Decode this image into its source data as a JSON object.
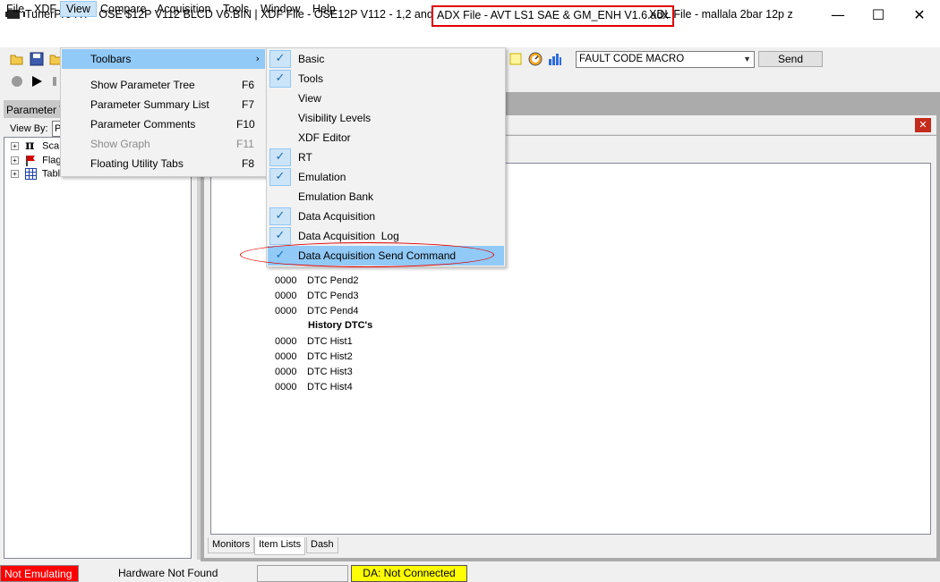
{
  "window": {
    "title_main": "TunerPro RT - OSE $12P V112 BLCD V6.BIN | XDF File - OSE12P V112 - 1,2 and 3 bar.xdf",
    "title_adx": "ADX File - AVT LS1 SAE & GM_ENH V1.6.adx",
    "title_xdl": "XDL File - mallala 2bar 12p z",
    "minimize": "—",
    "maximize": "☐",
    "close": "✕"
  },
  "menubar": {
    "items": [
      "File",
      "XDF",
      "View",
      "Compare",
      "Acquisition",
      "Tools",
      "Window",
      "Help"
    ],
    "active": "View"
  },
  "toolbar": {
    "macro_select": "FAULT CODE MACRO",
    "send_label": "Send"
  },
  "param_panel": {
    "title": "Parameter T",
    "viewby_label": "View By:",
    "viewby_value": "P",
    "tree": [
      {
        "label": "Sca",
        "icon": "pi-icon"
      },
      {
        "label": "Flag",
        "icon": "flag-icon"
      },
      {
        "label": "Tables",
        "icon": "table-icon"
      }
    ]
  },
  "view_menu": {
    "items": [
      {
        "label": "Toolbars",
        "key": "",
        "submenu": true,
        "highlighted": true
      },
      {
        "label": "Show Parameter Tree",
        "key": "F6"
      },
      {
        "label": "Parameter Summary List",
        "key": "F7"
      },
      {
        "label": "Parameter Comments",
        "key": "F10"
      },
      {
        "label": "Show Graph",
        "key": "F11",
        "disabled": true
      },
      {
        "label": "Floating Utility Tabs",
        "key": "F8"
      }
    ]
  },
  "toolbars_menu": {
    "items": [
      {
        "label": "Basic",
        "checked": true
      },
      {
        "label": "Tools",
        "checked": true
      },
      {
        "label": "View",
        "checked": false
      },
      {
        "label": "Visibility Levels",
        "checked": false
      },
      {
        "label": "XDF Editor",
        "checked": false
      },
      {
        "label": "RT",
        "checked": true
      },
      {
        "label": "Emulation",
        "checked": true
      },
      {
        "label": "Emulation Bank",
        "checked": false
      },
      {
        "label": "Data Acquisition",
        "checked": true
      },
      {
        "label": "Data Acquisition  Log",
        "checked": true
      },
      {
        "label": "Data Acquisition Send Command",
        "checked": true,
        "highlighted": true
      }
    ],
    "check_glyph": "✓"
  },
  "dtc_list": {
    "pending": [
      {
        "code": "0000",
        "name": "DTC Pend2"
      },
      {
        "code": "0000",
        "name": "DTC Pend3"
      },
      {
        "code": "0000",
        "name": "DTC Pend4"
      }
    ],
    "history_heading": "History DTC's",
    "history": [
      {
        "code": "0000",
        "name": "DTC Hist1"
      },
      {
        "code": "0000",
        "name": "DTC Hist2"
      },
      {
        "code": "0000",
        "name": "DTC Hist3"
      },
      {
        "code": "0000",
        "name": "DTC Hist4"
      }
    ]
  },
  "bottom_tabs": [
    "Monitors",
    "Item Lists",
    "Dash"
  ],
  "bottom_tab_active": "Item Lists",
  "child_close": "✕",
  "status": {
    "emulation": "Not Emulating",
    "hardware": "Hardware Not Found",
    "da": "DA: Not Connected"
  },
  "colors": {
    "highlight": "#91c9f7",
    "check_bg": "#cce4f7",
    "annotation_red": "#e00000",
    "status_red": "#ff0000",
    "status_yellow": "#ffff00"
  }
}
